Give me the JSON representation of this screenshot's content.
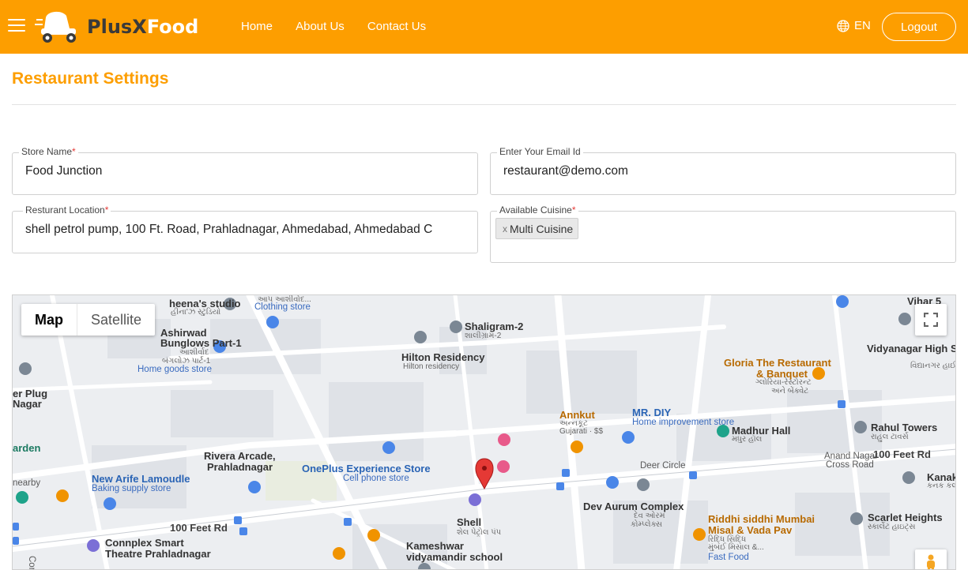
{
  "header": {
    "brand_plus": "PlusX",
    "brand_food": "Food",
    "nav": [
      {
        "label": "Home"
      },
      {
        "label": "About Us"
      },
      {
        "label": "Contact Us"
      }
    ],
    "language": "EN",
    "logout_label": "Logout",
    "bg_color": "#fd9e00"
  },
  "page": {
    "title": "Restaurant Settings"
  },
  "form": {
    "store_name": {
      "label": "Store Name",
      "required": "*",
      "value": "Food Junction"
    },
    "email": {
      "label": "Enter Your Email Id",
      "value": "restaurant@demo.com"
    },
    "location": {
      "label": "Resturant Location",
      "required": "*",
      "value": "shell petrol pump, 100 Ft. Road, Prahladnagar, Ahmedabad, Ahmedabad C"
    },
    "cuisine": {
      "label": "Available Cuisine",
      "required": "*",
      "chips": [
        {
          "remove": "x",
          "label": "Multi Cuisine"
        }
      ]
    }
  },
  "map": {
    "type_map": "Map",
    "type_satellite": "Satellite",
    "labels": {
      "heenas_studio": "heena's studio",
      "heenas_studio_guj": "હીના'ઝ સ્ટુડિયો",
      "ashirwad": "Ashirwad",
      "bunglows": "Bunglows Part-1",
      "ashirwad_guj": "આશીર્વાદ",
      "bunglows_guj": "બંગલોઝ પાર્ટ-1",
      "home_goods": "Home goods store",
      "app_ashirwad": "આપ આશીર્વાદ...",
      "clothing": "Clothing store",
      "shaligram": "Shaligram-2",
      "shaligram_guj": "શાલીગ્રામ-2",
      "hilton": "Hilton Residency",
      "hilton_sub": "Hilton residency",
      "vidyanagar": "Vidyanagar High School",
      "vidyanagar_guj": "વિદ્યાનગર હાઈસ્કૂલ",
      "gloria": "Gloria The Restaurant",
      "gloria2": "& Banquet",
      "gloria_guj": "ગ્લોરિયા-રેસ્ટોરન્ટ",
      "gloria_guj2": "અને બેંક્વેટ",
      "vihar": "Vihar 5",
      "annkut": "Annkut",
      "annkut_guj": "અન્નકૂટ",
      "annkut_sub": "Gujarati · $$",
      "mrdiy": "MR. DIY",
      "mrdiy_sub": "Home improvement store",
      "madhur": "Madhur Hall",
      "madhur_guj": "મધુર હૉલ",
      "rahul": "Rahul Towers",
      "rahul_guj": "રાહુલ ટાવર્સ",
      "plug": "er Plug",
      "nagar": "Nagar",
      "garden": "arden",
      "rivera": "Rivera Arcade,",
      "rivera2": "Prahladnagar",
      "oneplus": "OnePlus Experience Store",
      "oneplus_sub": "Cell phone store",
      "deer": "Deer Circle",
      "anand": "Anand Nagar",
      "anand2": "Cross Road",
      "feet100_r": "100 Feet Rd",
      "kanak": "Kanak K",
      "kanak_guj": "કનક કલા -",
      "new_arife": "New Arife Lamoudle",
      "baking": "Baking supply store",
      "dev_aurum": "Dev Aurum Complex",
      "dev_guj": "દેવ ઓરમ",
      "dev_guj2": "કોમ્પ્લેક્સ",
      "siddhi": "Riddhi siddhi Mumbai",
      "misal": "Misal & Vada Pav",
      "siddhi_guj": "રિદ્ધિ સિદ્ધિ",
      "siddhi_guj2": "મુંબઈ મિસાલ &...",
      "fast_food": "Fast Food",
      "scarlet": "Scarlet Heights",
      "scarlet_guj": "સ્કાર્લેટ હાઇટ્સ",
      "feet100_l": "100 Feet Rd",
      "shell": "Shell",
      "shell_guj": "શેલ પેટ્રોલ પંપ",
      "connplex": "Connplex Smart",
      "theatre": "Theatre Prahladnagar",
      "kameshwar": "Kameshwar",
      "vidyamandir": "vidyamandir school",
      "corpo": "Corpo",
      "nearby": "nearby"
    }
  }
}
